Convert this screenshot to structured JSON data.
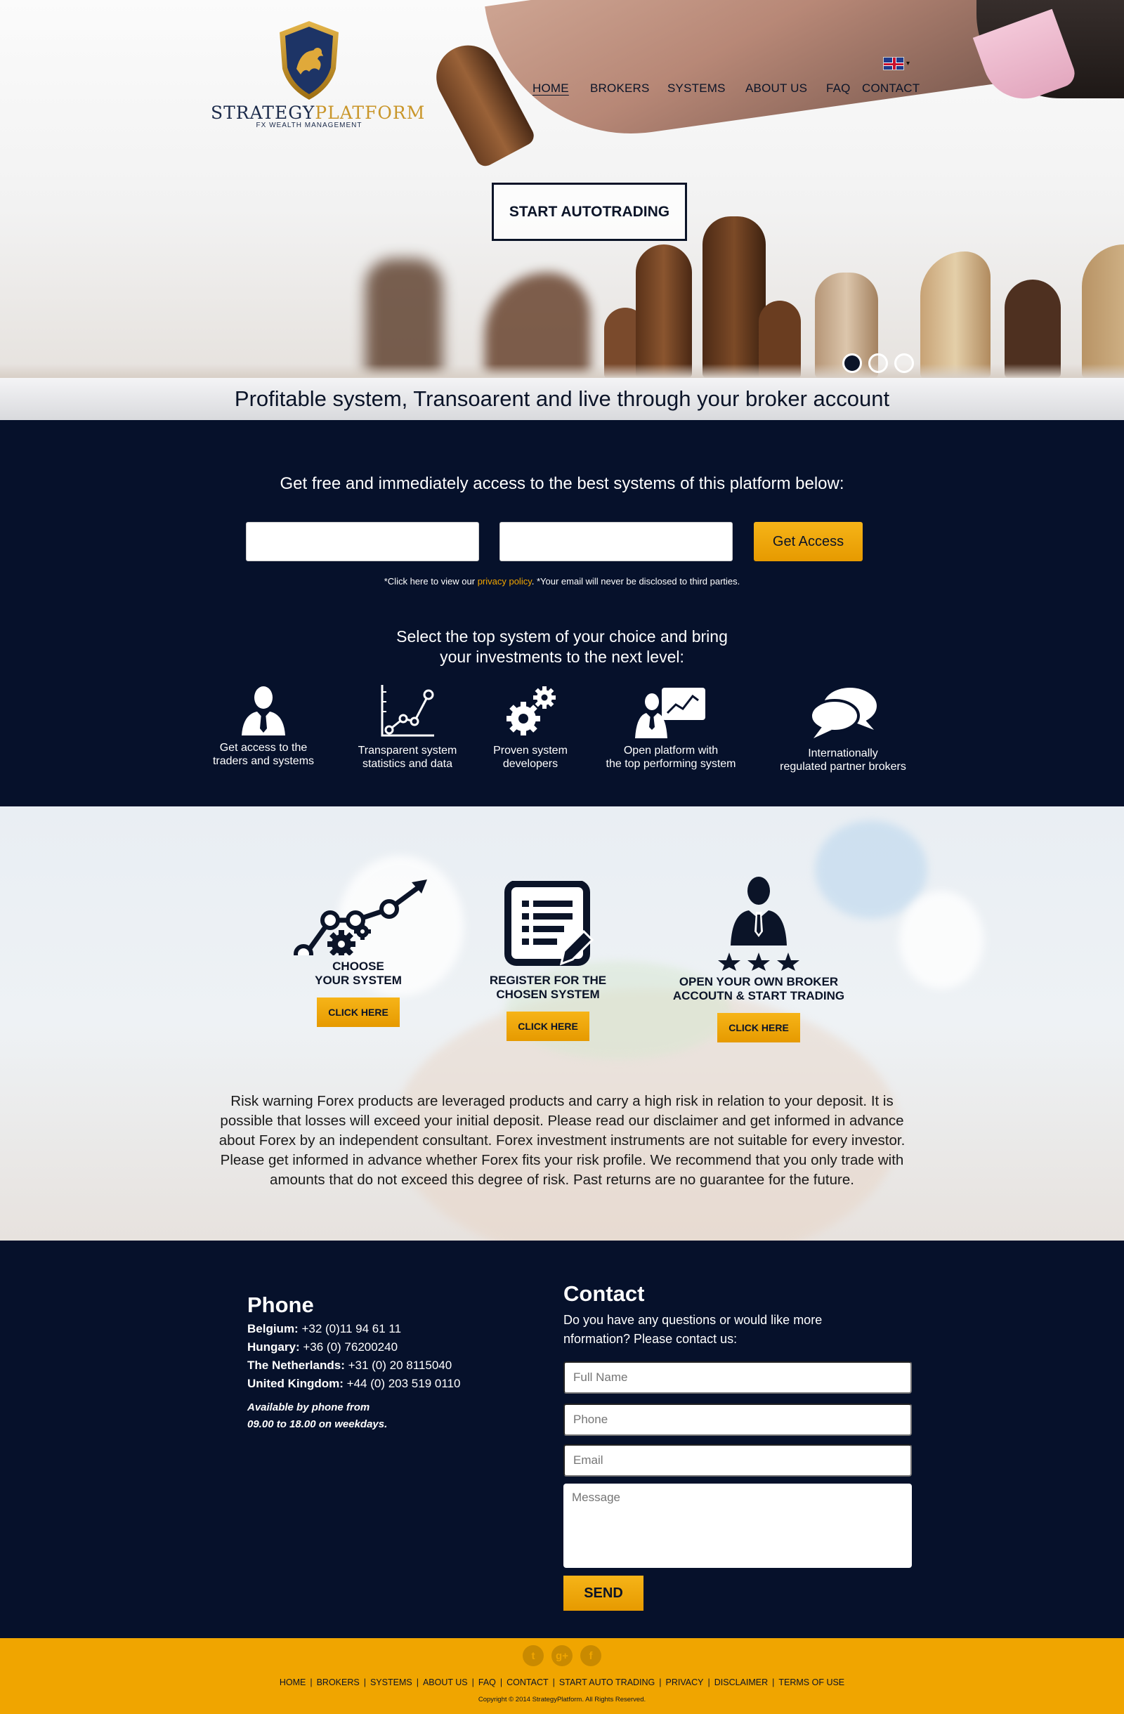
{
  "logo": {
    "brand_part1": "STRATEGY",
    "brand_part2": "PLATFORM",
    "sub": "FX WEALTH MANAGEMENT"
  },
  "language": {
    "icon": "uk-flag-icon",
    "caret": "▾"
  },
  "nav": {
    "items": [
      "HOME",
      "BROKERS",
      "SYSTEMS",
      "ABOUT US",
      "FAQ",
      "CONTACT"
    ],
    "active": "HOME"
  },
  "hero": {
    "cta_label": "START AUTOTRADING",
    "slides": 3,
    "active_slide": 1
  },
  "tagline": "Profitable system, Transoarent and live through your broker account",
  "access": {
    "title": "Get free and immediately access  to the best systems of this platform below:",
    "input1_value": "",
    "input2_value": "",
    "button_label": "Get Access",
    "policy_prefix": "*Click here to view our ",
    "policy_link": "privacy policy",
    "policy_suffix": ". *Your email will never be disclosed to third parties."
  },
  "select": {
    "line1": "Select the top system of your choice and bring",
    "line2": "your investments to the next level:"
  },
  "features": [
    {
      "icon": "businessman-icon",
      "line1": "Get access to the",
      "line2": "traders and systems"
    },
    {
      "icon": "line-chart-icon",
      "line1": "Transparent system",
      "line2": "statistics and data"
    },
    {
      "icon": "gears-icon",
      "line1": "Proven system",
      "line2": "developers"
    },
    {
      "icon": "presenter-chart-icon",
      "line1": "Open platform with",
      "line2": "the top performing system"
    },
    {
      "icon": "speech-bubbles-icon",
      "line1": "Internationally",
      "line2": "regulated partner brokers"
    }
  ],
  "steps": [
    {
      "icon": "chart-gears-icon",
      "line1": "CHOOSE",
      "line2": "YOUR SYSTEM",
      "button": "CLICK HERE"
    },
    {
      "icon": "form-pencil-icon",
      "line1": "REGISTER FOR THE",
      "line2": "CHOSEN SYSTEM",
      "button": "CLICK HERE"
    },
    {
      "icon": "businessman-stars-icon",
      "line1": "OPEN YOUR OWN BROKER",
      "line2": "ACCOUTN & START TRADING",
      "button": "CLICK HERE"
    }
  ],
  "risk_warning": "Risk warning Forex products are leveraged products and carry a high risk in relation to your deposit. It is possible that losses will exceed your initial deposit. Please read our disclaimer and get informed in advance about Forex by an independent consultant. Forex investment instruments are not suitable for every investor. Please get informed in advance whether Forex fits your risk profile. We recommend that you only trade with amounts that do not exceed this degree of risk. Past returns are no guarantee for the future.",
  "phone": {
    "title": "Phone",
    "lines": [
      {
        "country": "Belgium:",
        "number": " +32 (0)11 94 61 11"
      },
      {
        "country": "Hungary:",
        "number": " +36 (0) 76200240"
      },
      {
        "country": "The Netherlands:",
        "number": " +31 (0) 20 8115040"
      },
      {
        "country": "United Kingdom:",
        "number": " +44 (0) 203 519 0110"
      }
    ],
    "avail_line1": "Available by phone from",
    "avail_line2": "09.00 to 18.00 on weekdays."
  },
  "contact": {
    "title": "Contact",
    "text": "Do you have any questions or would like more nformation? Please contact us:",
    "placeholders": {
      "name": "Full Name",
      "phone": "Phone",
      "email": "Email",
      "message": "Message"
    },
    "send_label": "SEND"
  },
  "footer": {
    "social": [
      {
        "icon": "twitter-icon",
        "glyph": "t"
      },
      {
        "icon": "google-plus-icon",
        "glyph": "g+"
      },
      {
        "icon": "facebook-icon",
        "glyph": "f"
      }
    ],
    "links": [
      "HOME",
      "BROKERS",
      "SYSTEMS",
      "ABOUT US",
      "FAQ",
      "CONTACT",
      "START AUTO TRADING",
      "PRIVACY",
      "DISCLAIMER",
      "TERMS OF USE"
    ],
    "separator": "|",
    "copyright": "Copyright © 2014 StrategyPlatform. All Rights Reserved."
  },
  "colors": {
    "navy": "#06112b",
    "gold": "#f0a500",
    "button_gold": "#e69a00"
  }
}
